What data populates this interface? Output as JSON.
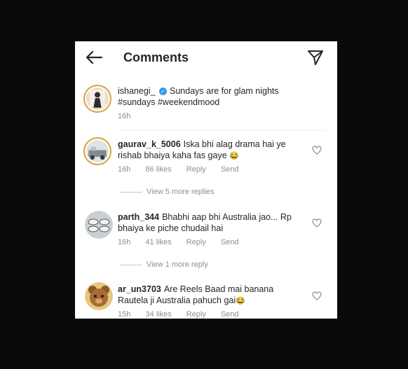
{
  "header": {
    "title": "Comments",
    "back_icon": "arrow-left-icon",
    "share_icon": "paper-plane-icon"
  },
  "caption": {
    "username": "ishanegi_",
    "verified": true,
    "text": "Sundays are for glam nights #sundays #weekendmood",
    "time": "16h"
  },
  "comments": [
    {
      "username": "gaurav_k_5006",
      "text": "Iska bhi alag drama hai ye rishab bhaiya kaha fas gaye",
      "emoji": "😂",
      "time": "16h",
      "likes": "86 likes",
      "reply": "Reply",
      "send": "Send",
      "view_replies": "View 5 more replies"
    },
    {
      "username": "parth_344",
      "text": "Bhabhi aap bhi Australia jao... Rp bhaiya ke piche chudail hai",
      "emoji": "",
      "time": "16h",
      "likes": "41 likes",
      "reply": "Reply",
      "send": "Send",
      "view_replies": "View 1 more reply"
    },
    {
      "username": "ar_un3703",
      "text": "Are  Reels Baad mai banana Rautela ji Australia pahuch gai",
      "emoji": "😂",
      "time": "15h",
      "likes": "34 likes",
      "reply": "Reply",
      "send": "Send",
      "view_replies": ""
    }
  ],
  "colors": {
    "verified": "#3897f0",
    "meta_text": "#8e8e8e",
    "story_ring": "#d6a23a"
  }
}
